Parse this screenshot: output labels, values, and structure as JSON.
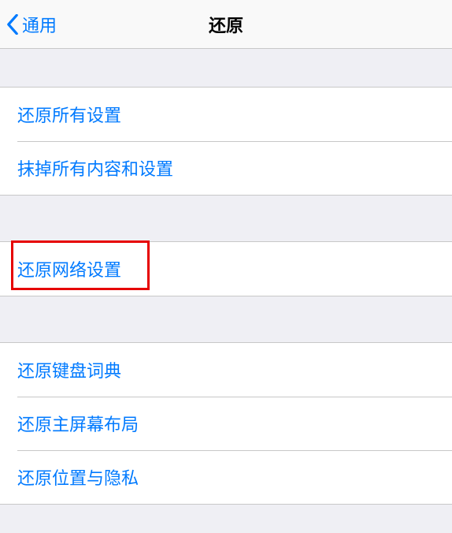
{
  "header": {
    "back_label": "通用",
    "title": "还原"
  },
  "sections": {
    "group1": {
      "item0": "还原所有设置",
      "item1": "抹掉所有内容和设置"
    },
    "group2": {
      "item0": "还原网络设置"
    },
    "group3": {
      "item0": "还原键盘词典",
      "item1": "还原主屏幕布局",
      "item2": "还原位置与隐私"
    }
  }
}
